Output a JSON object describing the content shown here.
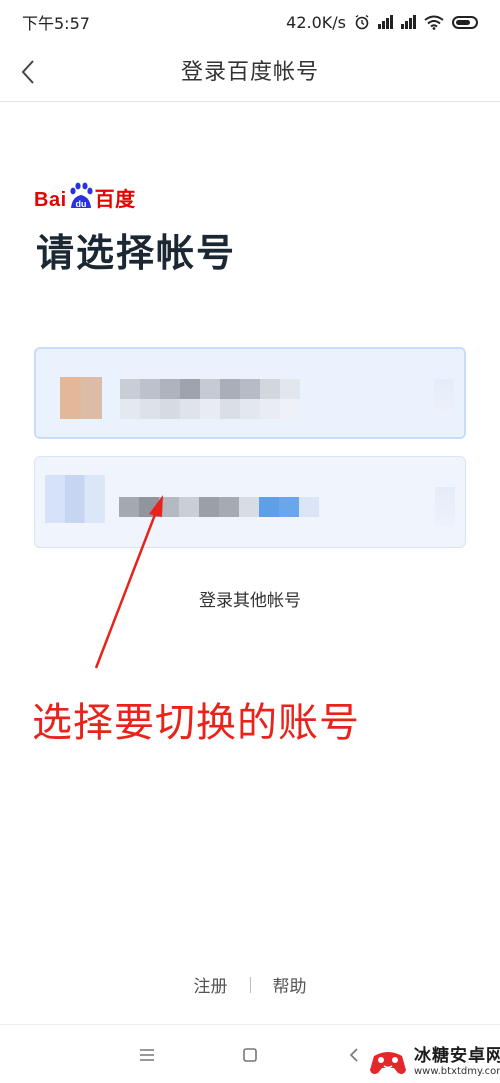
{
  "status_bar": {
    "time": "下午5:57",
    "speed": "42.0K/s",
    "icons": [
      "alarm-icon",
      "hd-signal-icon",
      "signal-icon",
      "wifi-icon",
      "battery-icon"
    ]
  },
  "nav": {
    "title": "登录百度帐号",
    "back_icon": "chevron-left-icon"
  },
  "logo": {
    "bai": "Bai",
    "du": "du",
    "cn": "百度"
  },
  "heading": "请选择帐号",
  "accounts": [
    {
      "selected": true
    },
    {
      "selected": false
    }
  ],
  "other_login": "登录其他帐号",
  "annotation": "选择要切换的账号",
  "footer": {
    "register": "注册",
    "help": "帮助"
  },
  "system_nav": {
    "icons": [
      "menu-icon",
      "home-icon",
      "back-icon"
    ]
  },
  "watermark": {
    "main": "冰糖安卓网",
    "sub": "www.btxtdmy.com"
  },
  "colors": {
    "brand_red": "#e10601",
    "annotation_red": "#e8231b",
    "card_bg": "#eaf2fe",
    "card_border": "#c8dcfb",
    "heading": "#1b2733"
  }
}
